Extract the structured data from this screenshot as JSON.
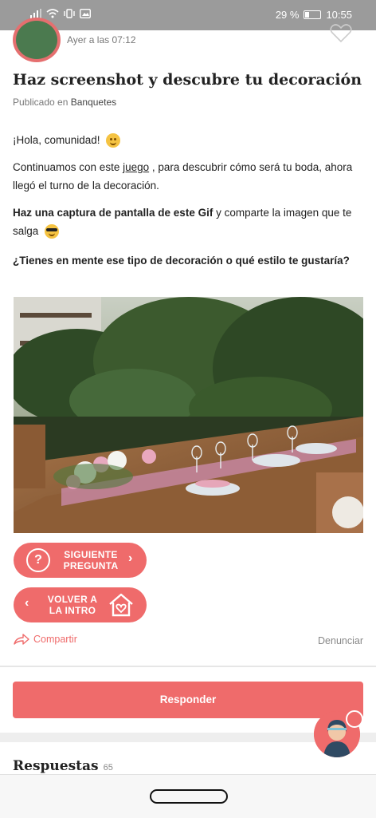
{
  "status_bar": {
    "battery_percent": "29 %",
    "time": "10:55"
  },
  "post": {
    "date": "Ayer a las 07:12",
    "title": "Haz screenshot y descubre tu decoración",
    "published_prefix": "Publicado en",
    "category": "Banquetes",
    "greeting": "¡Hola, comunidad!",
    "p2_before": "Continuamos con este",
    "p2_link": "juego",
    "p2_after": ", para descubrir cómo será tu boda, ahora llegó el turno de la decoración.",
    "p3_bold": "Haz una captura de pantalla de este Gif",
    "p3_rest": "y comparte la imagen que te salga",
    "p4_bold": "¿Tienes en mente ese tipo de decoración o qué estilo te gustaría?"
  },
  "buttons": {
    "next_line1": "SIGUIENTE",
    "next_line2": "PREGUNTA",
    "back_line1": "VOLVER A",
    "back_line2": "LA INTRO",
    "share": "Compartir",
    "report": "Denunciar",
    "respond": "Responder"
  },
  "answers": {
    "title": "Respuestas",
    "count": "65"
  },
  "colors": {
    "accent": "#ef6b6b"
  }
}
